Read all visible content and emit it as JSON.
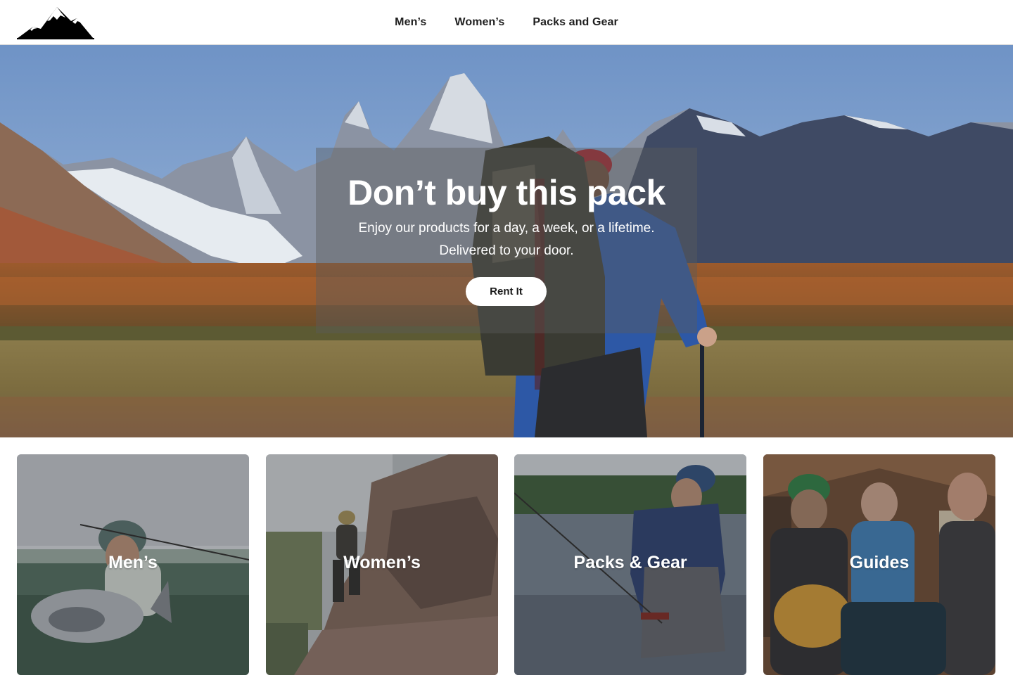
{
  "header": {
    "logo_icon": "mountain-logo-icon",
    "nav": [
      {
        "label": "Men’s"
      },
      {
        "label": "Women’s"
      },
      {
        "label": "Packs and Gear"
      }
    ]
  },
  "hero": {
    "title": "Don’t buy this pack",
    "subtitle_line1": "Enjoy our products for a day, a week, or a lifetime.",
    "subtitle_line2": "Delivered to your door.",
    "cta_label": "Rent It",
    "image_icon": "hiker-mountain-photo"
  },
  "categories": [
    {
      "label": "Men’s",
      "image_icon": "angler-fish-photo"
    },
    {
      "label": "Women’s",
      "image_icon": "rock-cliff-photo"
    },
    {
      "label": "Packs & Gear",
      "image_icon": "river-wader-photo"
    },
    {
      "label": "Guides",
      "image_icon": "workshop-group-photo"
    }
  ]
}
